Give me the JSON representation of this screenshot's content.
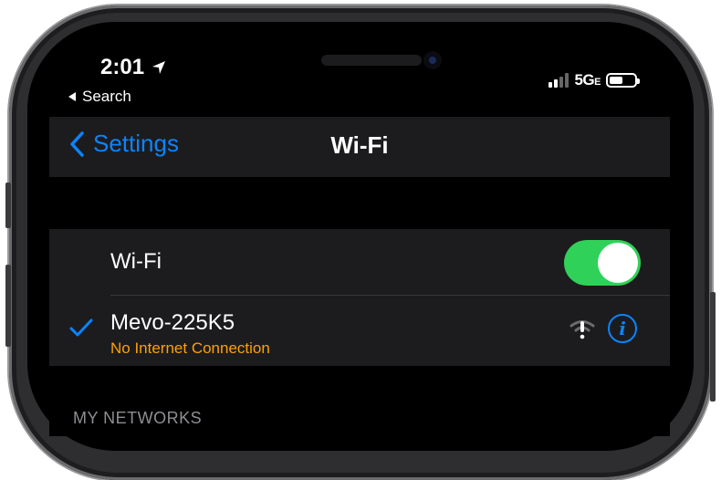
{
  "status_bar": {
    "time": "2:01",
    "back_app": "Search",
    "network": "5G",
    "network_suffix": "E"
  },
  "nav": {
    "back_label": "Settings",
    "title": "Wi-Fi"
  },
  "wifi": {
    "label": "Wi-Fi",
    "enabled": true
  },
  "connected_network": {
    "name": "Mevo-225K5",
    "status": "No Internet Connection"
  },
  "sections": {
    "my_networks": "MY NETWORKS"
  },
  "colors": {
    "accent": "#0a84ff",
    "toggle_on": "#30d158",
    "warning_text": "#ff9f0a"
  }
}
